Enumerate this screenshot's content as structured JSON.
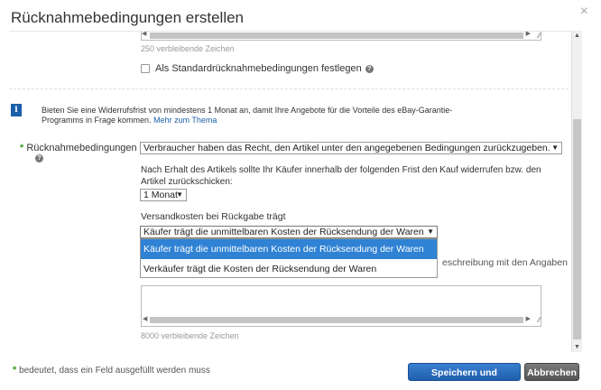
{
  "dialog": {
    "title": "Rücknahmebedingungen erstellen",
    "close_glyph": "×"
  },
  "upper": {
    "chars_remaining": "250 verbleibende Zeichen",
    "std_checkbox_label": "Als Standardrücknahmebedingungen festlegen",
    "std_checkbox_checked": false
  },
  "info": {
    "badge": "i",
    "text": "Bieten Sie eine Widerrufsfrist von mindestens 1 Monat an, damit Ihre Angebote für die Vorteile des eBay-Garantie-Programms in Frage kommen.",
    "link": "Mehr zum Thema"
  },
  "returns": {
    "required_mark": "*",
    "label": "Rücknahmebedingungen",
    "main_select": "Verbraucher haben das Recht, den Artikel unter den angegebenen Bedingungen zurückzugeben.",
    "description": "Nach Erhalt des Artikels sollte Ihr Käufer innerhalb der folgenden Frist den Kauf widerrufen bzw. den Artikel zurückschicken:",
    "period_select": "1 Monat",
    "shipping_label": "Versandkosten bei Rückgabe trägt",
    "shipping_select": "Käufer trägt die unmittelbaren Kosten der Rücksendung der Waren",
    "shipping_options": [
      "Käufer trägt die unmittelbaren Kosten der Rücksendung der Waren",
      "Verkäufer trägt die Kosten der Rücksendung der Waren"
    ],
    "shipping_selected_index": 0,
    "behind_text": "eschreibung mit den Angaben",
    "chars_remaining": "8000 verbleibende Zeichen"
  },
  "footer": {
    "required_mark": "*",
    "note": "bedeutet, dass ein Feld ausgefüllt werden muss",
    "save_label": "Speichern und schließen",
    "cancel_label": "Abbrechen"
  },
  "colors": {
    "required_green": "#3a9d23",
    "info_blue": "#1b5fa8",
    "selected_blue": "#2f82d4"
  }
}
